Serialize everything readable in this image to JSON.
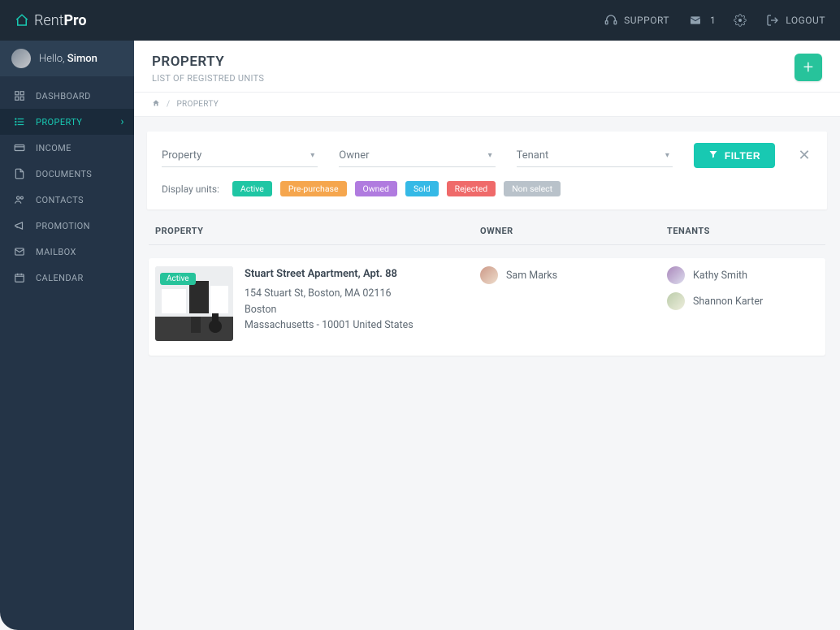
{
  "brand": {
    "prefix": "Rent",
    "suffix": "Pro"
  },
  "topbar": {
    "support_label": "SUPPORT",
    "mail_count": "1",
    "logout_label": "LOGOUT"
  },
  "user": {
    "hello": "Hello,",
    "name": "Simon"
  },
  "sidebar": {
    "items": [
      {
        "label": "DASHBOARD"
      },
      {
        "label": "PROPERTY"
      },
      {
        "label": "INCOME"
      },
      {
        "label": "DOCUMENTS"
      },
      {
        "label": "CONTACTS"
      },
      {
        "label": "PROMOTION"
      },
      {
        "label": "MAILBOX"
      },
      {
        "label": "CALENDAR"
      }
    ]
  },
  "header": {
    "title": "PROPERTY",
    "subtitle": "LIST OF REGISTRED UNITS"
  },
  "breadcrumb": {
    "current": "PROPERTY"
  },
  "filters": {
    "property_placeholder": "Property",
    "owner_placeholder": "Owner",
    "tenant_placeholder": "Tenant",
    "filter_label": "FILTER",
    "display_units_label": "Display units:",
    "chips": {
      "active": "Active",
      "pre": "Pre-purchase",
      "owned": "Owned",
      "sold": "Sold",
      "rejected": "Rejected",
      "nonselect": "Non select"
    }
  },
  "table": {
    "col_property": "PROPERTY",
    "col_owner": "OWNER",
    "col_tenants": "TENANTS"
  },
  "rows": [
    {
      "badge": "Active",
      "title": "Stuart Street Apartment, Apt. 88",
      "line1": "154 Stuart St, Boston, MA 02116",
      "line2": "Boston",
      "line3": "Massachusetts - 10001 United States",
      "owner": "Sam Marks",
      "tenants": [
        "Kathy Smith",
        "Shannon Karter"
      ]
    }
  ]
}
